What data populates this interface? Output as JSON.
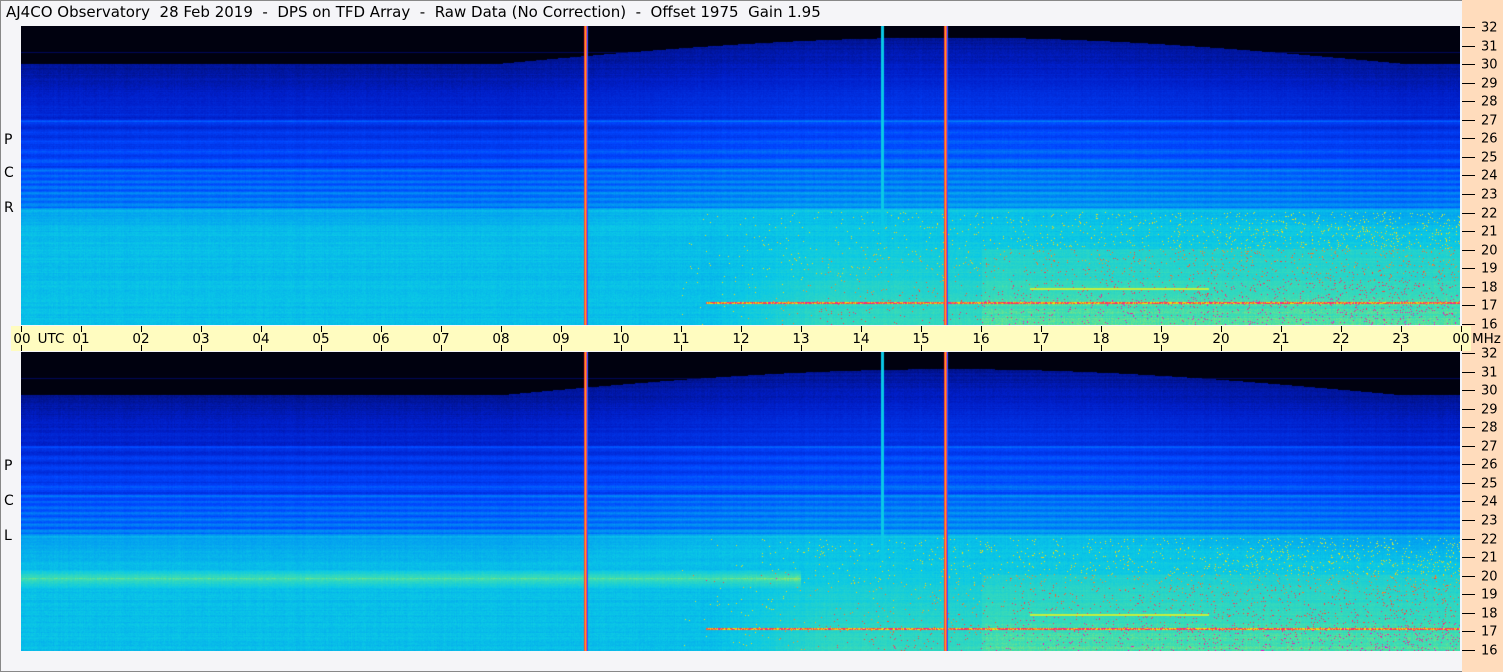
{
  "title": "AJ4CO Observatory  28 Feb 2019  -  DPS on TFD Array  -  Raw Data (No Correction)  -  Offset 1975  Gain 1.95",
  "panels": [
    {
      "id": "rcp",
      "label": [
        "R",
        "C",
        "P"
      ]
    },
    {
      "id": "lcp",
      "label": [
        "L",
        "C",
        "P"
      ]
    }
  ],
  "time_axis": {
    "labels": [
      "00",
      "01",
      "02",
      "03",
      "04",
      "05",
      "06",
      "07",
      "08",
      "09",
      "10",
      "11",
      "12",
      "13",
      "14",
      "15",
      "16",
      "17",
      "18",
      "19",
      "20",
      "21",
      "22",
      "23",
      "00"
    ],
    "utc_label": "UTC",
    "unit_label": "MHz"
  },
  "freq_axis": {
    "labels": [
      "32",
      "31",
      "30",
      "29",
      "28",
      "27",
      "26",
      "25",
      "24",
      "23",
      "22",
      "21",
      "20",
      "19",
      "18",
      "17",
      "16"
    ],
    "min_mhz": 16,
    "max_mhz": 32
  },
  "vertical_lines_hours": {
    "red": [
      9.4,
      15.4
    ],
    "cyan": [
      14.35
    ]
  },
  "colors": {
    "band": "#fffcc0",
    "right": "#ffdcbc"
  }
}
